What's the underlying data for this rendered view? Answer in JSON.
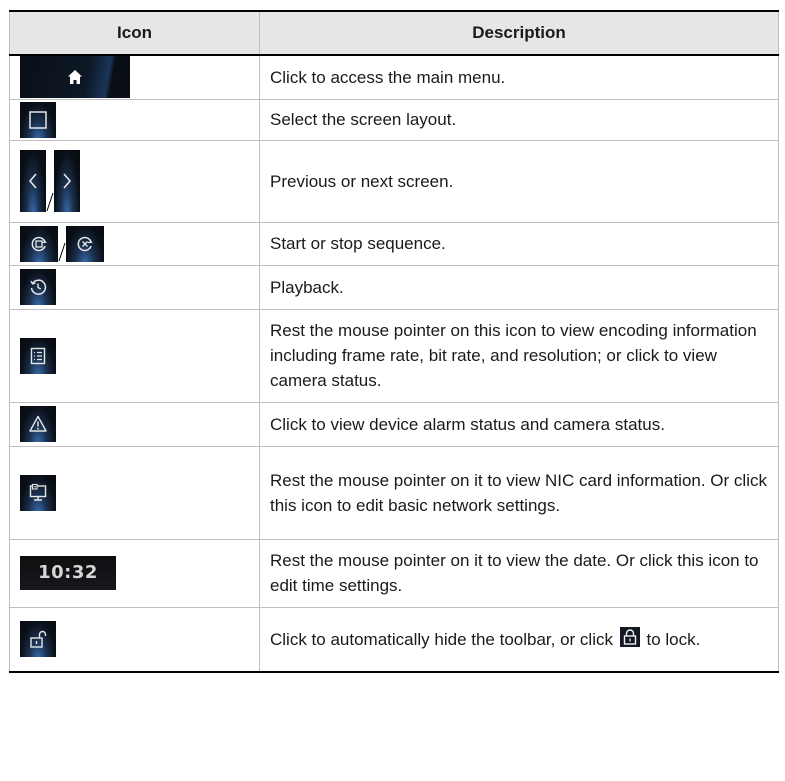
{
  "table": {
    "headers": {
      "icon": "Icon",
      "description": "Description"
    },
    "rows": [
      {
        "icon": "home-icon",
        "description": "Click to access the main menu."
      },
      {
        "icon": "screen-layout-icon",
        "description": "Select the screen layout."
      },
      {
        "icon": "prev-next-icon",
        "description": "Previous or next screen."
      },
      {
        "icon": "sequence-start-stop-icon",
        "description": "Start or stop sequence."
      },
      {
        "icon": "playback-icon",
        "description": "Playback."
      },
      {
        "icon": "encoding-info-icon",
        "description": "Rest the mouse pointer on this icon to view encoding information including frame rate, bit rate, and resolution; or click to view camera status."
      },
      {
        "icon": "alarm-warning-icon",
        "description": "Click to view device alarm status and camera status."
      },
      {
        "icon": "network-icon",
        "description": "Rest the mouse pointer on it to view NIC card information. Or click this icon to edit basic network settings."
      },
      {
        "icon": "time-display-icon",
        "clock_text": "10:32",
        "description": "Rest the mouse pointer on it to view the date. Or click this icon to edit time settings."
      },
      {
        "icon": "unlock-icon",
        "inline_icon": "lock-icon",
        "description_before": "Click to automatically hide the toolbar, or click",
        "description_after": "to lock."
      }
    ]
  }
}
